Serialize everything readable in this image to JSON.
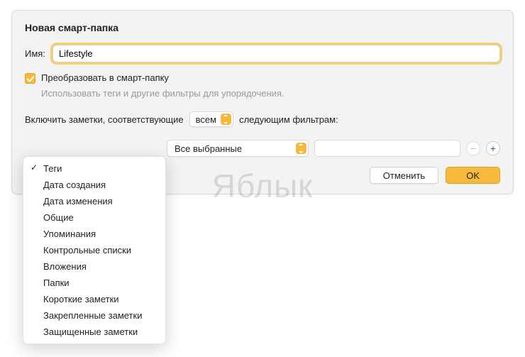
{
  "dialog": {
    "title": "Новая смарт-папка",
    "name_label": "Имя:",
    "name_value": "Lifestyle",
    "convert_label": "Преобразовать в смарт-папку",
    "convert_hint": "Использовать теги и другие фильтры для упорядочения.",
    "include_prefix": "Включить заметки, соответствующие",
    "include_match": "всем",
    "include_suffix": "следующим фильтрам:",
    "filter_scope": "Все выбранные",
    "cancel": "Отменить",
    "ok": "OK"
  },
  "watermark": "Яблык",
  "menu": {
    "items": [
      "Теги",
      "Дата создания",
      "Дата изменения",
      "Общие",
      "Упоминания",
      "Контрольные списки",
      "Вложения",
      "Папки",
      "Короткие заметки",
      "Закрепленные заметки",
      "Защищенные заметки"
    ],
    "selected_index": 0
  }
}
